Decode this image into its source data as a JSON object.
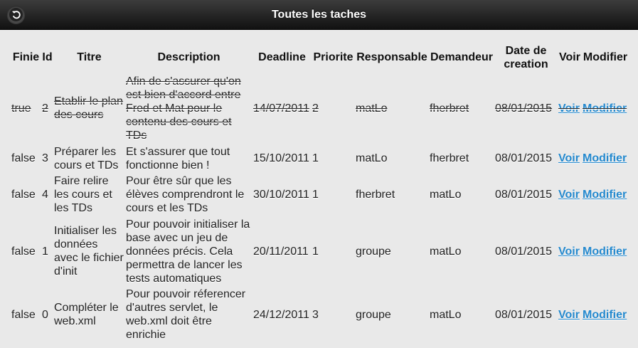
{
  "header": {
    "title": "Toutes les taches",
    "back_icon": "back-arrow-icon"
  },
  "table": {
    "columns": [
      "Finie",
      "Id",
      "Titre",
      "Description",
      "Deadline",
      "Priorite",
      "Responsable",
      "Demandeur",
      "Date de creation",
      "Voir",
      "Modifier"
    ],
    "rows": [
      {
        "finie": "true",
        "id": "2",
        "titre": "Etablir le plan des cours",
        "description": "Afin de s'assurer qu'on est bien d'accord entre Fred et Mat pour le contenu des cours et TDs",
        "deadline": "14/07/2011",
        "priorite": "2",
        "responsable": "matLo",
        "demandeur": "fherbret",
        "date_creation": "08/01/2015",
        "voir": "Voir",
        "modifier": "Modifier"
      },
      {
        "finie": "false",
        "id": "3",
        "titre": "Préparer les cours et TDs",
        "description": "Et s'assurer que tout fonctionne bien !",
        "deadline": "15/10/2011",
        "priorite": "1",
        "responsable": "matLo",
        "demandeur": "fherbret",
        "date_creation": "08/01/2015",
        "voir": "Voir",
        "modifier": "Modifier"
      },
      {
        "finie": "false",
        "id": "4",
        "titre": "Faire relire les cours et les TDs",
        "description": "Pour être sûr que les élèves comprendront le cours et les TDs",
        "deadline": "30/10/2011",
        "priorite": "1",
        "responsable": "fherbret",
        "demandeur": "matLo",
        "date_creation": "08/01/2015",
        "voir": "Voir",
        "modifier": "Modifier"
      },
      {
        "finie": "false",
        "id": "1",
        "titre": "Initialiser les données avec le fichier d'init",
        "description": "Pour pouvoir initialiser la base avec un jeu de données précis. Cela permettra de lancer les tests automatiques",
        "deadline": "20/11/2011",
        "priorite": "1",
        "responsable": "groupe",
        "demandeur": "matLo",
        "date_creation": "08/01/2015",
        "voir": "Voir",
        "modifier": "Modifier"
      },
      {
        "finie": "false",
        "id": "0",
        "titre": "Compléter le web.xml",
        "description": "Pour pouvoir réferencer d'autres servlet, le web.xml doit être enrichie",
        "deadline": "24/12/2011",
        "priorite": "3",
        "responsable": "groupe",
        "demandeur": "matLo",
        "date_creation": "08/01/2015",
        "voir": "Voir",
        "modifier": "Modifier"
      }
    ]
  },
  "colors": {
    "link": "#2489ce",
    "header_bg": "#1f1f1f",
    "page_bg": "#e9e9e9"
  }
}
